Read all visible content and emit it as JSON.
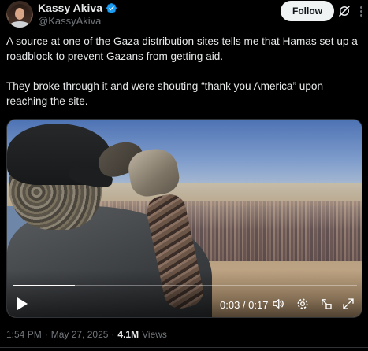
{
  "author": {
    "display_name": "Kassy Akiva",
    "handle": "@KassyAkiva",
    "verified": true,
    "verified_color": "#1d9bf0"
  },
  "header": {
    "follow_label": "Follow",
    "grok_icon": "grok-icon",
    "more_icon": "more-icon"
  },
  "tweet": {
    "paragraphs": [
      "A source at one of the Gaza distribution sites tells me that Hamas set up a roadblock to prevent Gazans from getting aid.",
      "They broke through it and were shouting “thank you America” upon reaching the site."
    ]
  },
  "video": {
    "time_display": "0:03 / 0:17",
    "progress_fraction": 0.18,
    "controls": [
      "play-icon",
      "volume-icon",
      "settings-icon",
      "pip-icon",
      "fullscreen-icon"
    ]
  },
  "meta": {
    "time": "1:54 PM",
    "separator": "·",
    "date": "May 27, 2025",
    "views_count": "4.1M",
    "views_label": "Views"
  },
  "colors": {
    "background": "#000000",
    "text": "#e7e9ea",
    "muted": "#71767b",
    "follow_bg": "#eff3f4"
  }
}
